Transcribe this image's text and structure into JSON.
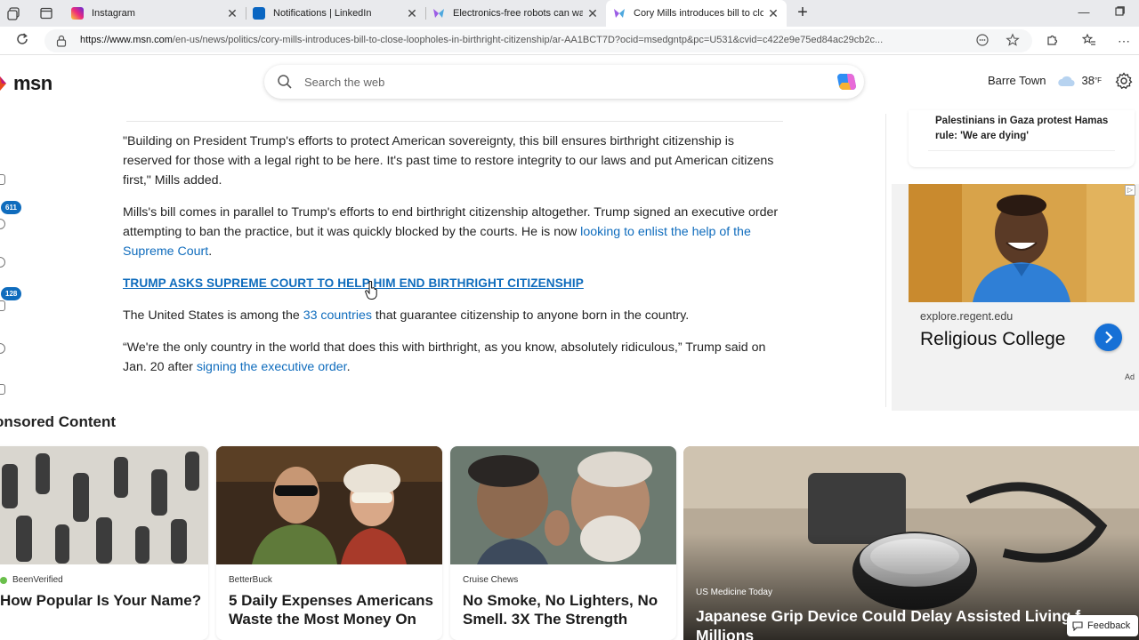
{
  "browser": {
    "tabs": [
      {
        "label": "Instagram",
        "icon": "instagram-icon",
        "color": "#d6249f"
      },
      {
        "label": "Notifications | LinkedIn",
        "icon": "linkedin-icon",
        "color": "#0a66c2"
      },
      {
        "label": "Electronics-free robots can walk a",
        "icon": "msn-icon",
        "color": "#8e6ad8"
      },
      {
        "label": "Cory Mills introduces bill to close",
        "icon": "msn-icon",
        "color": "#8e6ad8",
        "active": true
      }
    ],
    "url_host": "https://www.msn.com",
    "url_path": "/en-us/news/politics/cory-mills-introduces-bill-to-close-loopholes-in-birthright-citizenship/ar-AA1BCT7D?ocid=msedgntp&pc=U531&cvid=c422e9e75ed84ac29cb2c..."
  },
  "header": {
    "logo_text": "msn",
    "search_placeholder": "Search the web",
    "location": "Barre Town",
    "temperature": "38",
    "temp_unit": "°F"
  },
  "left_rail": {
    "badges": [
      "611",
      "128"
    ]
  },
  "article": {
    "p1": "\"Building on President Trump's efforts to protect American sovereignty, this bill ensures birthright citizenship is reserved for those with a legal right to be here. It's past time to restore integrity to our laws and put American citizens first,\" Mills added.",
    "p2_before": "Mills's bill comes in parallel to Trump's efforts to end birthright citizenship altogether. Trump signed an executive order attempting to ban the practice, but it was quickly blocked by the courts. He is now ",
    "p2_link": "looking to enlist the help of the Supreme Court",
    "p2_after": ".",
    "headline_link": "TRUMP ASKS SUPREME COURT TO HELP HIM END BIRTHRIGHT CITIZENSHIP",
    "p3_before": "The United States is among the ",
    "p3_link": "33 countries",
    "p3_after": " that guarantee citizenship to anyone born in the country.",
    "p4_before": "“We're the only country in the world that does this with birthright, as you know, absolutely ridiculous,” Trump said on Jan. 20 after ",
    "p4_link": "signing the executive order",
    "p4_after": "."
  },
  "right_rail": {
    "news_title": "Palestinians in Gaza protest Hamas rule: 'We are dying'",
    "ad": {
      "domain": "explore.regent.edu",
      "headline": "Religious College",
      "label": "Ad"
    }
  },
  "sponsored": {
    "title": "onsored Content",
    "cards": [
      {
        "source": "BeenVerified",
        "title": "How Popular Is Your Name?"
      },
      {
        "source": "BetterBuck",
        "title": "5 Daily Expenses Americans Waste the Most Money On"
      },
      {
        "source": "Cruise Chews",
        "title": "No Smoke, No Lighters, No Smell. 3X The Strength"
      }
    ],
    "big_card": {
      "source": "US Medicine Today",
      "title": "Japanese Grip Device Could Delay Assisted Living f... Millions"
    },
    "feedback_label": "Feedback"
  }
}
